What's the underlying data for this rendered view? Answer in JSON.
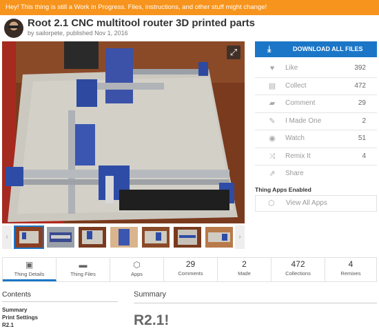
{
  "banner": "Hey! This thing is still a Work in Progress. Files, instructions, and other stuff might change!",
  "thing": {
    "title": "Root 2.1 CNC multitool router 3D printed parts",
    "by": "by",
    "author": "sailorpete",
    "published": ", published Nov 1, 2016"
  },
  "icons": {
    "expand": "expand-icon",
    "download": "download-icon",
    "like": "heart-icon",
    "collect": "stack-icon",
    "comment": "speech-bubble-icon",
    "made": "pencil-square-icon",
    "watch": "eye-icon",
    "remix": "shuffle-icon",
    "share": "share-icon",
    "apps": "cube-icon",
    "details": "document-icon",
    "files": "folder-icon",
    "prev": "chevron-left-icon",
    "next": "chevron-right-icon"
  },
  "colors": {
    "banner": "#f7941d",
    "accent": "#1b76c7"
  },
  "download_label": "DOWNLOAD ALL FILES",
  "actions": [
    {
      "label": "Like",
      "count": "392"
    },
    {
      "label": "Collect",
      "count": "472"
    },
    {
      "label": "Comment",
      "count": "29"
    },
    {
      "label": "I Made One",
      "count": "2"
    },
    {
      "label": "Watch",
      "count": "51"
    },
    {
      "label": "Remix It",
      "count": "4"
    },
    {
      "label": "Share",
      "count": ""
    }
  ],
  "apps": {
    "title": "Thing Apps Enabled",
    "view": "View All Apps"
  },
  "tabs": [
    {
      "label": "Thing Details"
    },
    {
      "label": "Thing Files"
    },
    {
      "label": "Apps"
    },
    {
      "num": "29",
      "label": "Comments"
    },
    {
      "num": "2",
      "label": "Made"
    },
    {
      "num": "472",
      "label": "Collections"
    },
    {
      "num": "4",
      "label": "Remixes"
    }
  ],
  "contents": {
    "title": "Contents",
    "links": [
      "Summary",
      "Print Settings",
      "R2.1"
    ]
  },
  "summary": {
    "title": "Summary",
    "text": "R2.1!"
  }
}
